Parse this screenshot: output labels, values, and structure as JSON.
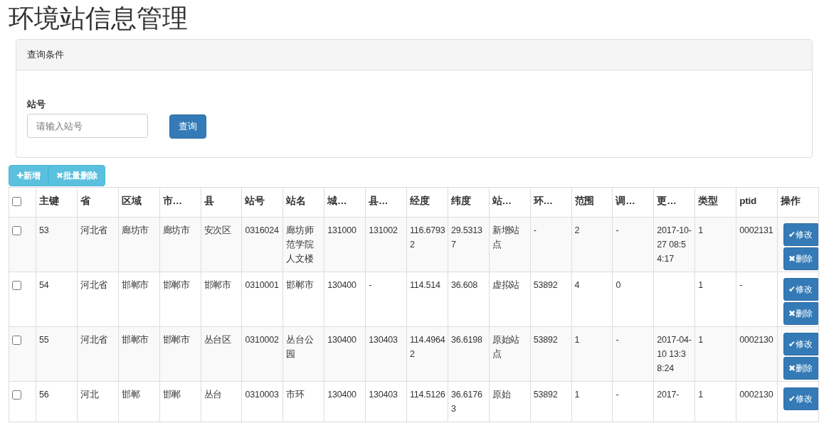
{
  "title": "环境站信息管理",
  "query_panel": {
    "heading": "查询条件",
    "field_label": "站号",
    "placeholder": "请输入站号",
    "button": "查询"
  },
  "toolbar": [
    {
      "icon": "✚",
      "label": "新增"
    },
    {
      "icon": "✖",
      "label": "批量删除"
    }
  ],
  "table": {
    "select_all_checked": false,
    "columns": [
      "主键",
      "省",
      "区域",
      "市…",
      "县",
      "站号",
      "站名",
      "城…",
      "县…",
      "经度",
      "纬度",
      "站…",
      "环…",
      "范围",
      "调…",
      "更…",
      "类型",
      "ptid",
      "操作"
    ],
    "rows": [
      {
        "checked": false,
        "cells": [
          "53",
          "河北省",
          "廊坊市",
          "廊坊市",
          "安次区",
          "0316024",
          "廊坊师范学院人文楼",
          "131000",
          "131002",
          "116.67932",
          "29.53137",
          "新增站点",
          "-",
          "2",
          "-",
          "2017-10-27 08:54:17",
          "1",
          "0002131"
        ],
        "actions": [
          {
            "icon": "✔",
            "label": "修改"
          },
          {
            "icon": "✖",
            "label": "删除"
          }
        ]
      },
      {
        "checked": false,
        "cells": [
          "54",
          "河北省",
          "邯郸市",
          "邯郸市",
          "邯郸市",
          "0310001",
          "邯郸市",
          "130400",
          "-",
          "114.514",
          "36.608",
          "虚拟站",
          "53892",
          "4",
          "0",
          "",
          "1",
          "-"
        ],
        "actions": [
          {
            "icon": "✔",
            "label": "修改"
          },
          {
            "icon": "✖",
            "label": "删除"
          }
        ]
      },
      {
        "checked": false,
        "cells": [
          "55",
          "河北省",
          "邯郸市",
          "邯郸市",
          "丛台区",
          "0310002",
          "丛台公园",
          "130400",
          "130403",
          "114.49642",
          "36.6198",
          "原始站点",
          "53892",
          "1",
          "-",
          "2017-04-10 13:38:24",
          "1",
          "0002130"
        ],
        "actions": [
          {
            "icon": "✔",
            "label": "修改"
          },
          {
            "icon": "✖",
            "label": "删除"
          }
        ]
      },
      {
        "checked": false,
        "cells": [
          "56",
          "河北",
          "邯郸",
          "邯郸",
          "丛台",
          "0310003",
          "市环",
          "130400",
          "130403",
          "114.5126",
          "36.61763",
          "原始",
          "53892",
          "1",
          "-",
          "2017-",
          "1",
          "0002130"
        ],
        "actions": [
          {
            "icon": "✔",
            "label": "修改"
          }
        ]
      }
    ]
  }
}
